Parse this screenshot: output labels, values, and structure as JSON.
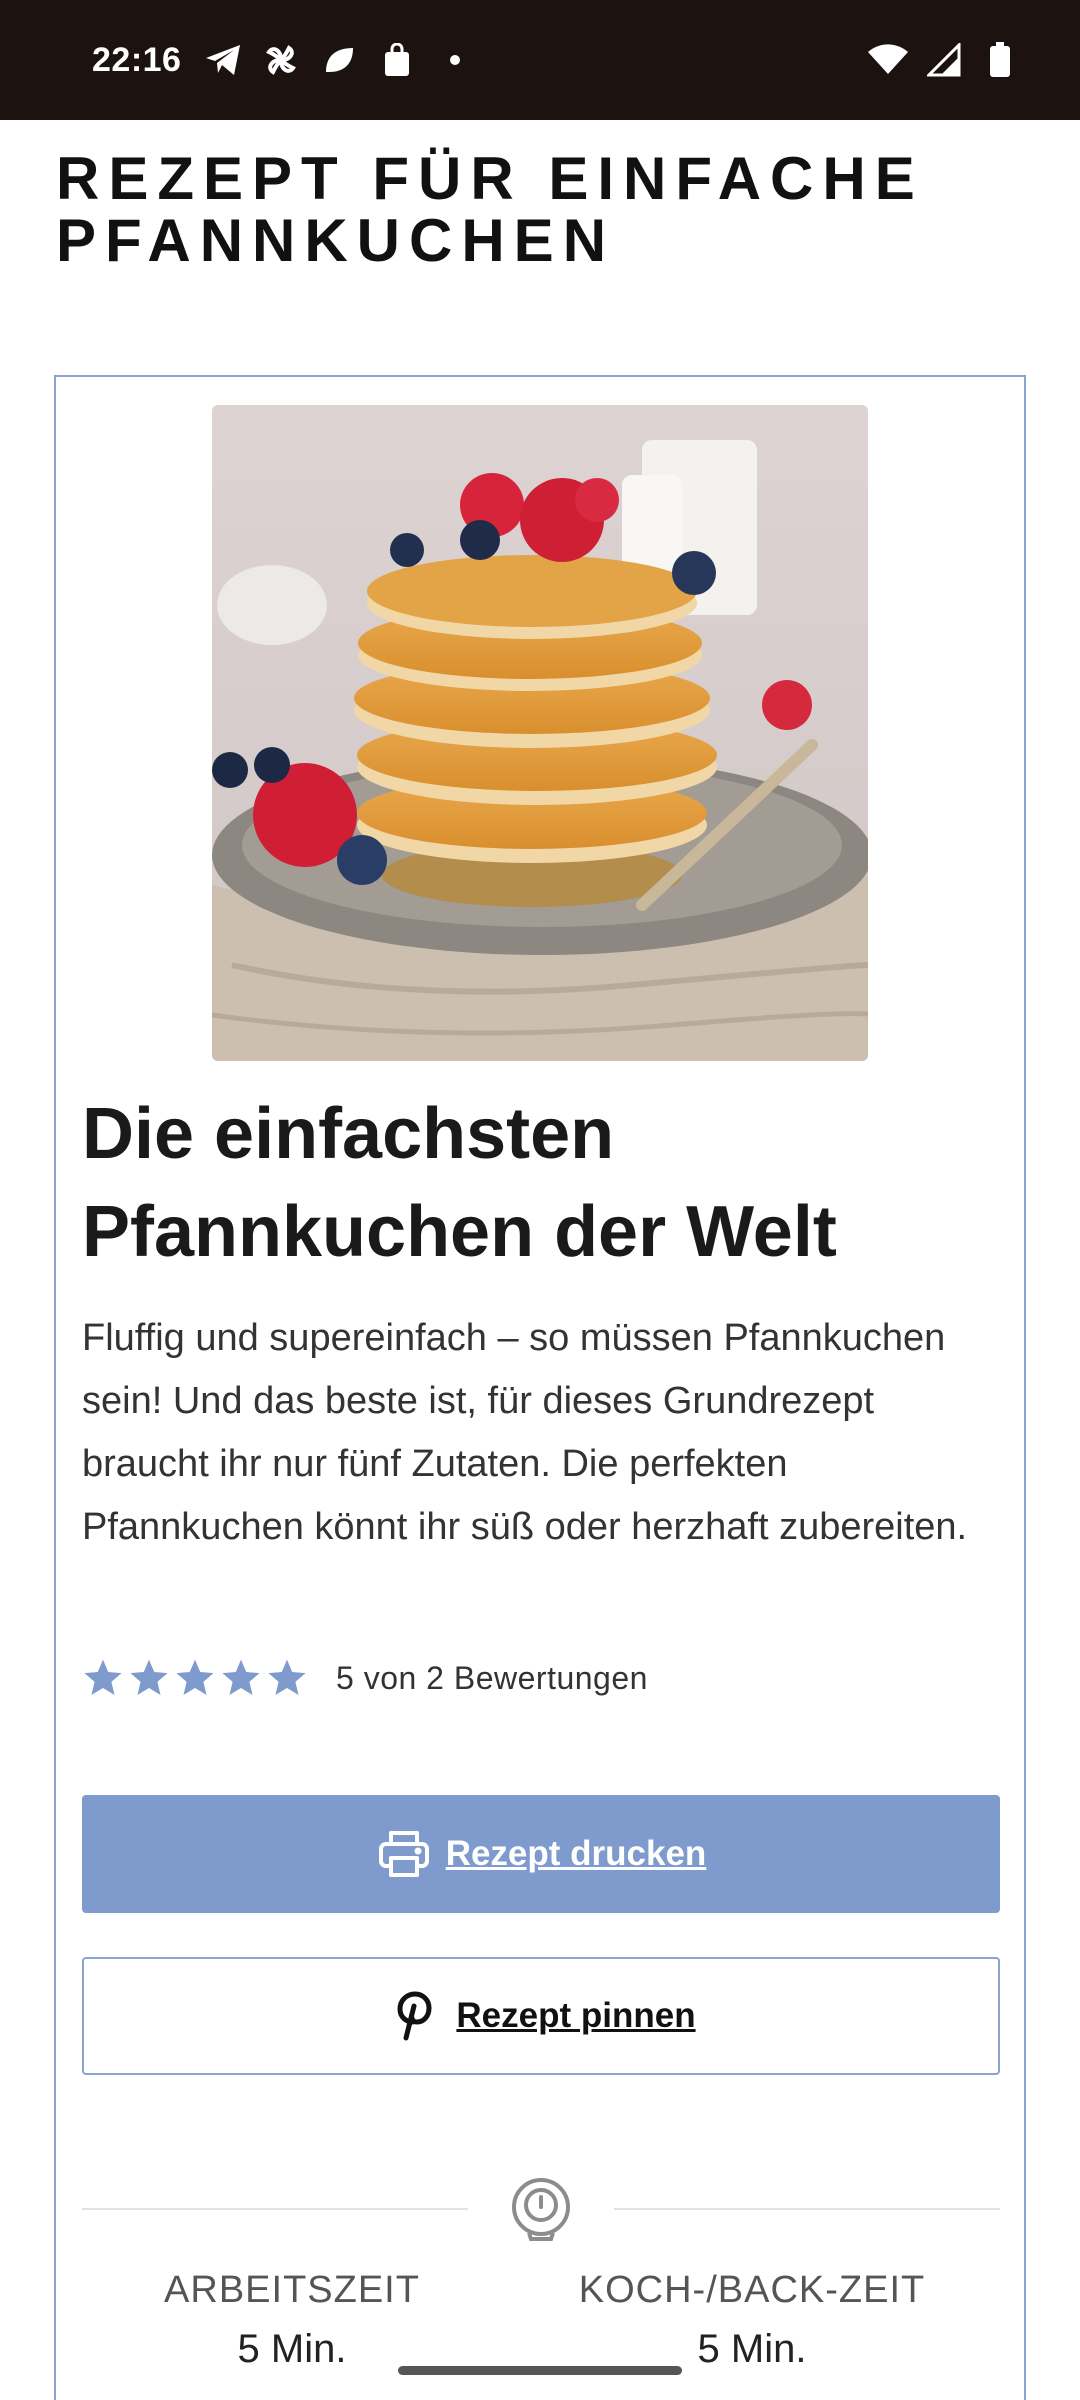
{
  "status_bar": {
    "time": "22:16",
    "left_icons": [
      "telegram-icon",
      "pinwheel-icon",
      "leaf-icon",
      "shopping-bag-icon",
      "dot-icon"
    ],
    "right_icons": [
      "wifi-icon",
      "cellular-signal-icon",
      "battery-icon"
    ]
  },
  "page": {
    "title": "REZEPT FÜR EINFACHE PFANNKUCHEN"
  },
  "recipe": {
    "image_alt": "pancakes-with-berries",
    "name": "Die einfachsten Pfannkuchen der Welt",
    "summary": "Fluffig und supereinfach – so müssen Pfannkuchen sein! Und das beste ist, für dieses Grundrezept braucht ihr nur fünf Zutaten. Die perfekten Pfannkuchen könnt ihr süß oder herzhaft zubereiten.",
    "rating": {
      "stars": 5,
      "max_stars": 5,
      "text": "5 von 2 Bewertungen",
      "star_color": "#7f9bcd"
    },
    "buttons": {
      "print_label": "Rezept drucken",
      "pin_label": "Rezept pinnen"
    },
    "times": {
      "work_label": "ARBEITSZEIT",
      "work_value": "5 Min.",
      "cook_label": "KOCH-/BACK-ZEIT",
      "cook_value": "5 Min."
    }
  },
  "colors": {
    "accent": "#7f9bcd",
    "border": "#8ba3cf",
    "status_bar_bg": "#1c1310"
  }
}
